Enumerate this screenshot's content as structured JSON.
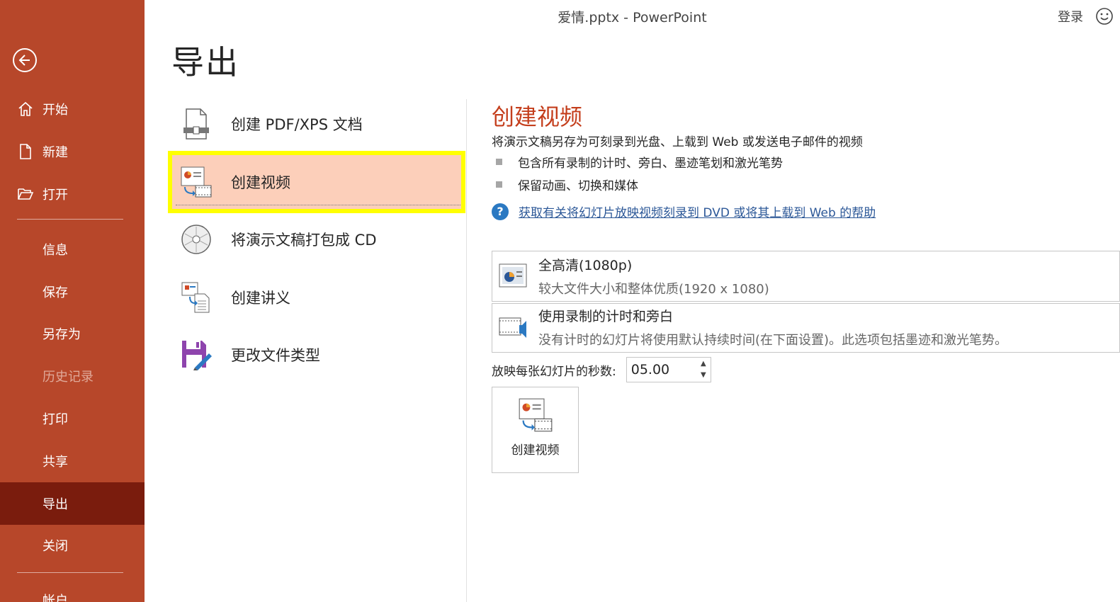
{
  "window": {
    "title": "爱情.pptx  -  PowerPoint",
    "signin": "登录"
  },
  "sidebar": {
    "top_items": [
      {
        "label": "开始",
        "icon": "home-icon"
      },
      {
        "label": "新建",
        "icon": "new-document-icon"
      },
      {
        "label": "打开",
        "icon": "open-folder-icon"
      }
    ],
    "sub_items": [
      {
        "label": "信息"
      },
      {
        "label": "保存"
      },
      {
        "label": "另存为"
      },
      {
        "label": "历史记录",
        "disabled": true
      },
      {
        "label": "打印"
      },
      {
        "label": "共享"
      },
      {
        "label": "导出",
        "active": true
      },
      {
        "label": "关闭"
      }
    ],
    "more_label": "帐户"
  },
  "page": {
    "title": "导出"
  },
  "export_options": [
    {
      "label": "创建 PDF/XPS 文档",
      "icon": "pdf-xps-icon"
    },
    {
      "label": "创建视频",
      "icon": "create-video-icon",
      "selected": true
    },
    {
      "label": "将演示文稿打包成 CD",
      "icon": "cd-icon"
    },
    {
      "label": "创建讲义",
      "icon": "handout-icon"
    },
    {
      "label": "更改文件类型",
      "icon": "save-file-type-icon"
    }
  ],
  "detail": {
    "title": "创建视频",
    "description": "将演示文稿另存为可刻录到光盘、上载到 Web 或发送电子邮件的视频",
    "bullets": [
      "包含所有录制的计时、旁白、墨迹笔划和激光笔势",
      "保留动画、切换和媒体"
    ],
    "help_link": "获取有关将幻灯片放映视频刻录到 DVD 或将其上载到 Web 的帮助",
    "quality": {
      "title": "全高清(1080p)",
      "subtitle": "较大文件大小和整体优质(1920 x 1080)"
    },
    "timing": {
      "title": "使用录制的计时和旁白",
      "subtitle": "没有计时的幻灯片将使用默认持续时间(在下面设置)。此选项包括墨迹和激光笔势。"
    },
    "seconds_label": "放映每张幻灯片的秒数:",
    "seconds_value": "05.00",
    "create_button": "创建视频"
  },
  "colors": {
    "sidebar": "#b7472a",
    "sidebar_active": "#7a1c0d",
    "accent": "#c43e1c",
    "selected_bg": "#fccfba",
    "highlight": "#ffff00",
    "link": "#2b5797"
  }
}
